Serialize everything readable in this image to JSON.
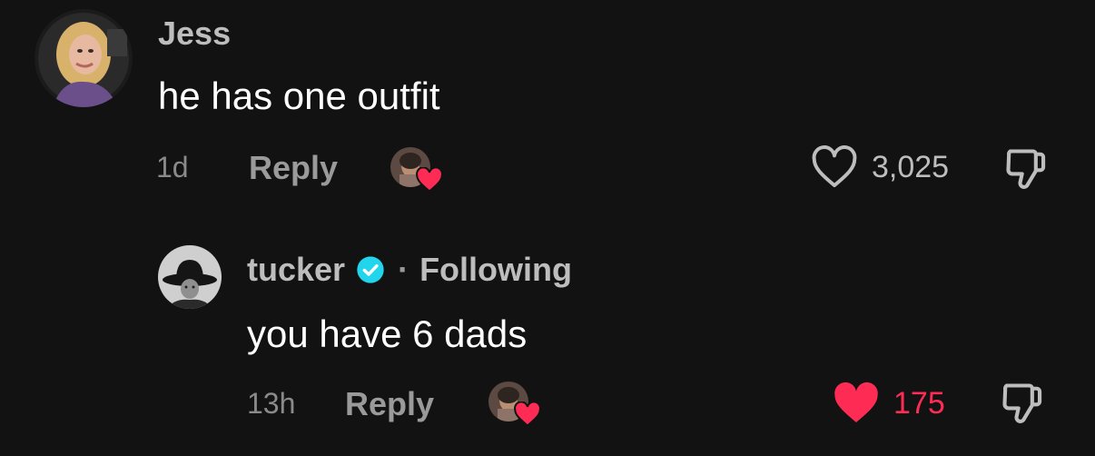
{
  "colors": {
    "background": "#121212",
    "liked_red": "#fe2c55",
    "verified_blue": "#20d5ec",
    "muted_text": "#9a9a9a"
  },
  "comments": [
    {
      "username": "Jess",
      "text": "he has one outfit",
      "time": "1d",
      "reply_label": "Reply",
      "creator_liked": true,
      "likes": "3,025",
      "liked": false,
      "avatar_icon": "user-photo-avatar",
      "like_icon": "heart-outline-icon",
      "dislike_icon": "thumbs-down-icon"
    }
  ],
  "replies": [
    {
      "username": "tucker",
      "verified": true,
      "relation": "Following",
      "separator": "·",
      "text": "you have 6 dads",
      "time": "13h",
      "reply_label": "Reply",
      "creator_liked": true,
      "likes": "175",
      "liked": true,
      "avatar_icon": "cowboy-hat-avatar",
      "like_icon": "heart-filled-icon",
      "dislike_icon": "thumbs-down-icon"
    }
  ]
}
